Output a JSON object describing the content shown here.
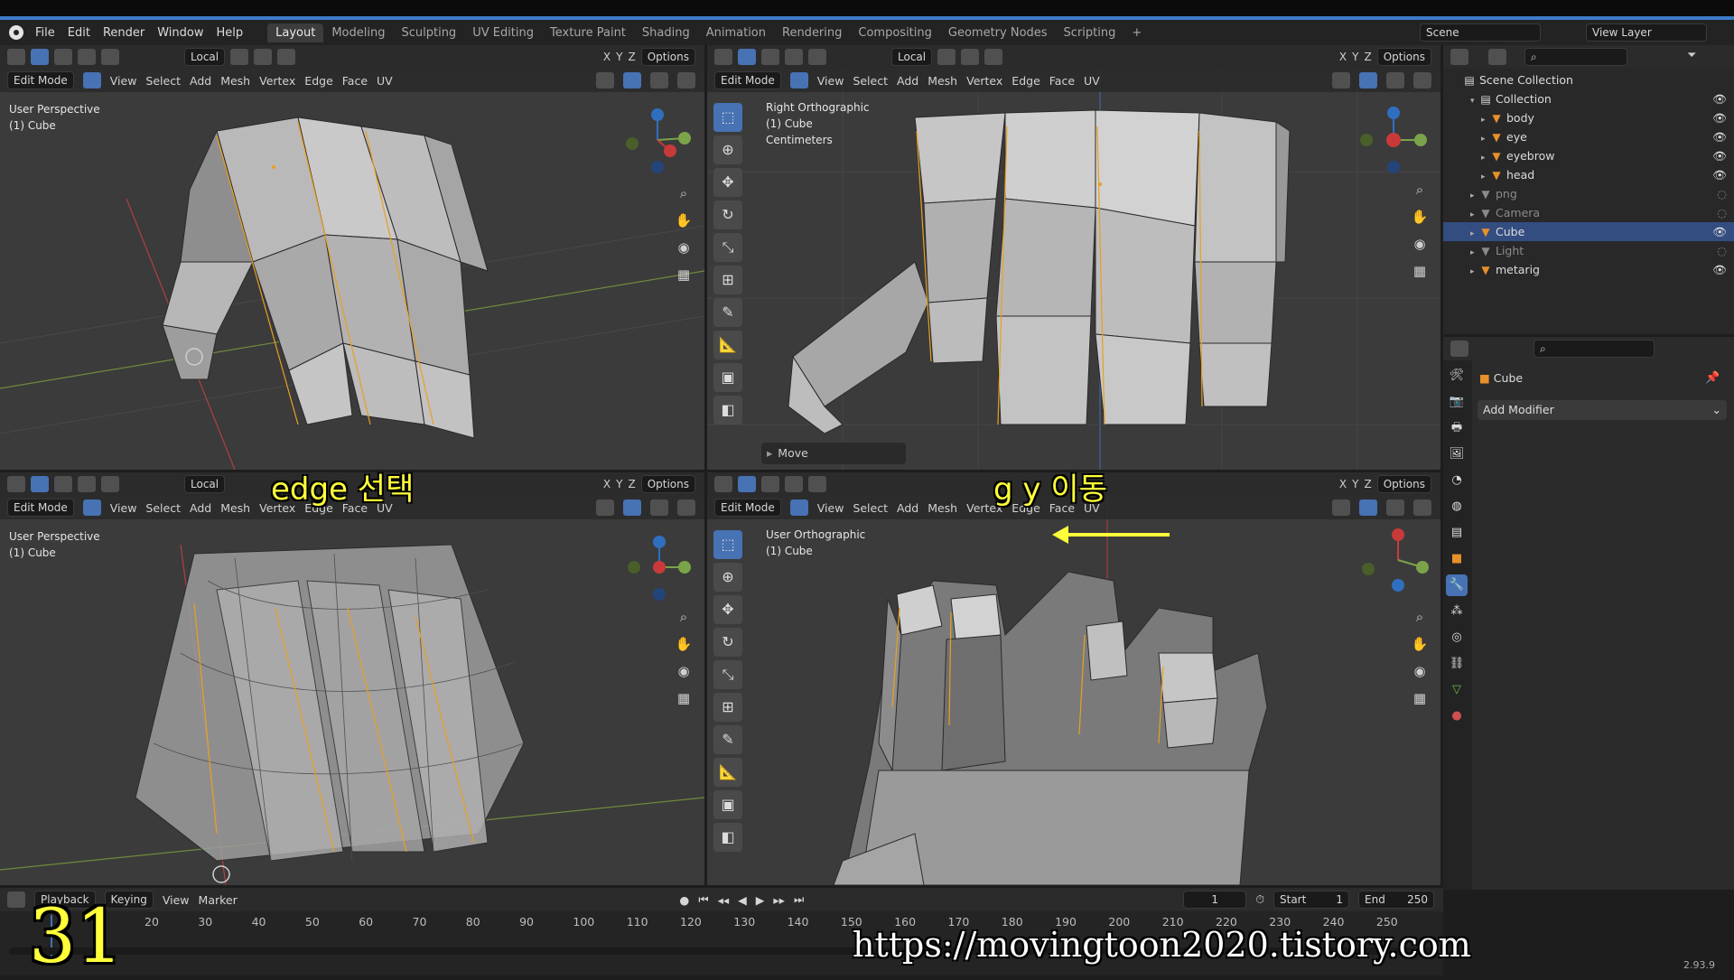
{
  "menu": {
    "items": [
      "File",
      "Edit",
      "Render",
      "Window",
      "Help"
    ],
    "workspaces": [
      "Layout",
      "Modeling",
      "Sculpting",
      "UV Editing",
      "Texture Paint",
      "Shading",
      "Animation",
      "Rendering",
      "Compositing",
      "Geometry Nodes",
      "Scripting"
    ],
    "active_workspace": "Layout",
    "add_tab": "+",
    "scene_label": "Scene",
    "view_layer_label": "View Layer"
  },
  "viewport_header": {
    "transform_orientation": "Local",
    "options": "Options",
    "axes": [
      "X",
      "Y",
      "Z"
    ],
    "mode": "Edit Mode",
    "menus": [
      "View",
      "Select",
      "Add",
      "Mesh",
      "Vertex",
      "Edge",
      "Face",
      "UV"
    ]
  },
  "viewports": {
    "top_left": {
      "line1": "User Perspective",
      "line2": "(1) Cube"
    },
    "top_right": {
      "line1": "Right Orthographic",
      "line2": "(1) Cube",
      "line3": "Centimeters",
      "operator_panel": "Move"
    },
    "bottom_left": {
      "line1": "User Perspective",
      "line2": "(1) Cube"
    },
    "bottom_right": {
      "line1": "User Orthographic",
      "line2": "(1) Cube"
    }
  },
  "overlays": {
    "edge_select": "edge 선택",
    "gy_move": "g y 이동",
    "frame_big": "31",
    "url": "https://movingtoon2020.tistory.com"
  },
  "outliner": {
    "root": "Scene Collection",
    "collection": "Collection",
    "items": [
      {
        "name": "body",
        "indent": 2,
        "selected": false,
        "dim": false
      },
      {
        "name": "eye",
        "indent": 2,
        "selected": false,
        "dim": false
      },
      {
        "name": "eyebrow",
        "indent": 2,
        "selected": false,
        "dim": false
      },
      {
        "name": "head",
        "indent": 2,
        "selected": false,
        "dim": false
      },
      {
        "name": "png",
        "indent": 1,
        "selected": false,
        "dim": true
      },
      {
        "name": "Camera",
        "indent": 1,
        "selected": false,
        "dim": true
      },
      {
        "name": "Cube",
        "indent": 1,
        "selected": true,
        "dim": false
      },
      {
        "name": "Light",
        "indent": 1,
        "selected": false,
        "dim": true
      },
      {
        "name": "metarig",
        "indent": 1,
        "selected": false,
        "dim": false
      }
    ]
  },
  "properties": {
    "object_name": "Cube",
    "add_modifier": "Add Modifier"
  },
  "timeline": {
    "menus": [
      "Playback",
      "Keying",
      "View",
      "Marker"
    ],
    "current_frame": "1",
    "start_label": "Start",
    "start_value": "1",
    "end_label": "End",
    "end_value": "250",
    "ticks": [
      "20",
      "30",
      "40",
      "50",
      "60",
      "70",
      "80",
      "90",
      "100",
      "110",
      "120",
      "130",
      "140",
      "150",
      "160",
      "170",
      "180",
      "190",
      "200",
      "210",
      "220",
      "230",
      "240",
      "250"
    ],
    "version": "2.93.9"
  },
  "colors": {
    "accent": "#4772b3",
    "edge_highlight": "#e8a020",
    "overlay_yellow": "#ffff3a"
  }
}
